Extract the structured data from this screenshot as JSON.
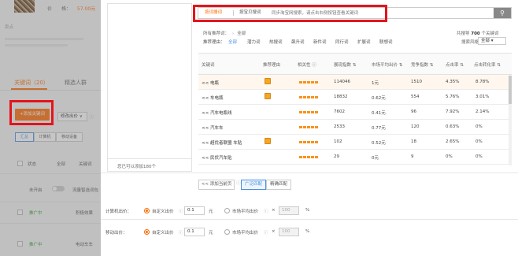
{
  "background": {
    "price_label": "价　　格：",
    "price_value": "57.00元",
    "desc_label": "卖点",
    "tabs": [
      "关键词（20）",
      "精选人群"
    ],
    "add_kw_button": "+添加关键词",
    "bid_select": "修改出价",
    "segments": [
      "汇总",
      "计算机",
      "移动设备"
    ],
    "status_filter": "状态",
    "status_value": "全部",
    "keyword_col": "关键词",
    "not_started": "未开启",
    "smart_match": "流量智选词包",
    "rows": [
      {
        "status": "推广中",
        "keyword": "积极效果"
      },
      {
        "status": "推广中",
        "keyword": "电动车车"
      }
    ],
    "accent": "#ff6a00"
  },
  "modal": {
    "left_pane_count": "您已可以添加180个",
    "search": {
      "tabs": [
        "按词搜词",
        "按宝贝搜词",
        "同步淘宝网搜索"
      ],
      "placeholder": "同步淘宝网搜索，请点击右侧按钮查看关键词",
      "button_icon": "search-icon"
    },
    "breadcrumb": {
      "label": "所有推荐词：",
      "value": "全部"
    },
    "total": {
      "prefix": "共搜导",
      "count": "700",
      "suffix": "个关键词"
    },
    "filters": {
      "label": "推荐理由：",
      "items": [
        "全部",
        "潜力词",
        "热搜词",
        "飙升词",
        "新件词",
        "同行词",
        "扩展词",
        "联想词"
      ],
      "sort_label": "搜索风格：",
      "sort_value": "全部"
    },
    "columns": [
      "关键词",
      "推荐理由",
      "相关性",
      "展现指数",
      "市场平均出价",
      "竞争指数",
      "点击率",
      "点击转化率"
    ],
    "rows": [
      {
        "keyword": "<< 电瓶",
        "reason": true,
        "impressions": "114046",
        "avg_bid": "1元",
        "competition": "1510",
        "ctr": "4.35%",
        "cvr": "8.78%",
        "highlight": true
      },
      {
        "keyword": "<< 车电瓶",
        "reason": true,
        "impressions": "18832",
        "avg_bid": "0.62元",
        "competition": "554",
        "ctr": "5.76%",
        "cvr": "3.01%",
        "highlight": false
      },
      {
        "keyword": "<< 汽车电瓶线",
        "reason": false,
        "impressions": "7602",
        "avg_bid": "0.41元",
        "competition": "96",
        "ctr": "7.92%",
        "cvr": "2.14%",
        "highlight": false
      },
      {
        "keyword": "<< 汽车车",
        "reason": false,
        "impressions": "2533",
        "avg_bid": "0.77元",
        "competition": "120",
        "ctr": "0.63%",
        "cvr": "0%",
        "highlight": false
      },
      {
        "keyword": "<< 超优者联盟 车贴",
        "reason": true,
        "impressions": "102",
        "avg_bid": "0.52元",
        "competition": "18",
        "ctr": "2.65%",
        "cvr": "0%",
        "highlight": false
      },
      {
        "keyword": "<< 民伏汽车贴",
        "reason": false,
        "impressions": "29",
        "avg_bid": "0元",
        "competition": "9",
        "ctr": "0%",
        "cvr": "0%",
        "highlight": false
      }
    ],
    "bottom_bar": {
      "add_all": "<< 添加当前页",
      "match": [
        "广泛匹配",
        "精确匹配"
      ]
    },
    "pc_bid": {
      "label": "计算机出价：",
      "custom": "自定义出价",
      "custom_value": "0.1",
      "unit": "元",
      "market": "市场平均出价",
      "times": "×",
      "percent_value": "100",
      "percent": "%"
    },
    "mobile_bid": {
      "label": "移动出价：",
      "custom": "自定义出价",
      "custom_value": "0.1",
      "unit": "元",
      "market": "市场平均出价",
      "times": "×",
      "percent_value": "100",
      "percent": "%"
    }
  }
}
